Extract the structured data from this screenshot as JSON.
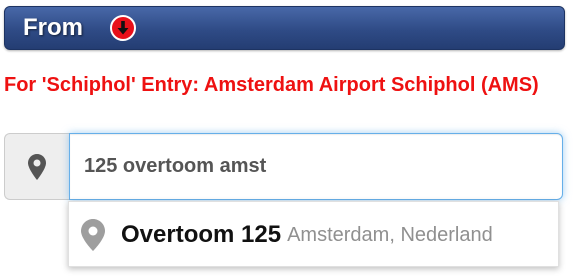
{
  "header": {
    "title": "From",
    "alert_icon": "alert-down-icon",
    "bar_color": "#2f4b86",
    "alert_color": "#e8101a"
  },
  "notice": {
    "text": "For 'Schiphol' Entry: Amsterdam Airport Schiphol (AMS)",
    "color": "#ee1111"
  },
  "search": {
    "addon_icon": "map-marker-icon",
    "value": "125 overtoom amst",
    "focus_color": "#66afe9"
  },
  "suggestions": [
    {
      "icon": "map-pin-icon",
      "main": "Overtoom 125",
      "secondary": "Amsterdam, Nederland"
    }
  ]
}
